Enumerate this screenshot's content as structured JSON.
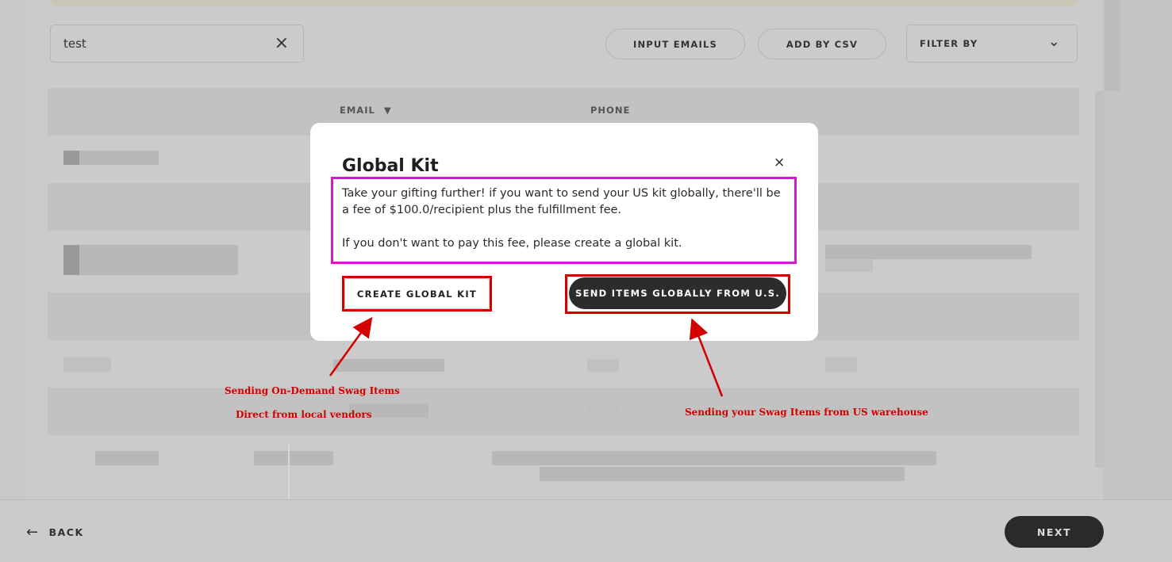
{
  "search": {
    "value": "test",
    "clear_icon": "×"
  },
  "toolbar": {
    "input_emails": "INPUT EMAILS",
    "add_by_csv": "ADD BY CSV",
    "filter_by": "FILTER BY",
    "filter_chevron": "⌄"
  },
  "table": {
    "headers": {
      "email": "EMAIL",
      "email_sort_icon": "▼",
      "phone": "PHONE"
    }
  },
  "footer": {
    "back_arrow": "←",
    "back": "BACK",
    "next": "NEXT"
  },
  "modal": {
    "title": "Global Kit",
    "close_icon": "×",
    "paragraph1": "Take your gifting further! if you want to send your US kit globally, there'll be a fee of $100.0/recipient plus the fulfillment fee.",
    "paragraph2": "If you don't want to pay this fee, please create a global kit.",
    "create_button": "CREATE GLOBAL KIT",
    "send_button": "SEND ITEMS GLOBALLY FROM U.S."
  },
  "annotations": {
    "left_line1": "Sending On-Demand Swag Items",
    "left_line2": "Direct from local vendors",
    "right_line": "Sending your Swag Items from US warehouse"
  },
  "colors": {
    "highlight_magenta": "#d01ad0",
    "highlight_red": "#d40000",
    "dark_button": "#2c2c2e",
    "overlay": "#c8c8c8"
  }
}
